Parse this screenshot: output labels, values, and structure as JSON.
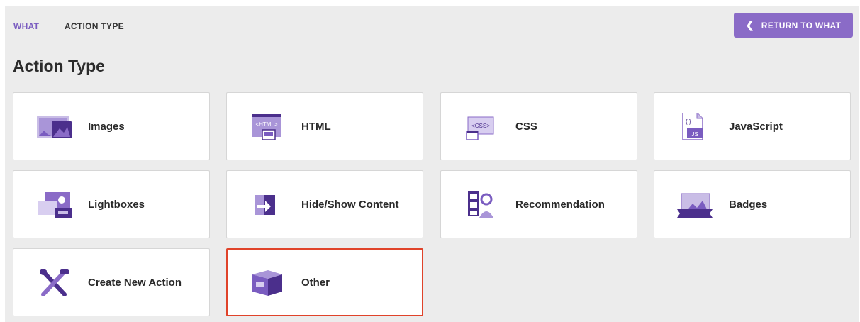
{
  "breadcrumb": {
    "parent": "WHAT",
    "current": "ACTION TYPE"
  },
  "return_button": {
    "label": "RETURN TO WHAT",
    "icon": "chevron-left-icon"
  },
  "page_title": "Action Type",
  "colors": {
    "accent": "#8a6bc7",
    "icon_dark": "#4b2f8c",
    "selected_border": "#e0432a"
  },
  "cards": [
    {
      "label": "Images",
      "icon": "images-icon"
    },
    {
      "label": "HTML",
      "icon": "html-icon",
      "icon_text": "<HTML>"
    },
    {
      "label": "CSS",
      "icon": "css-icon",
      "icon_text": "<CSS>"
    },
    {
      "label": "JavaScript",
      "icon": "javascript-icon",
      "icon_text": "JS"
    },
    {
      "label": "Lightboxes",
      "icon": "lightboxes-icon"
    },
    {
      "label": "Hide/Show Content",
      "icon": "hide-show-icon"
    },
    {
      "label": "Recommendation",
      "icon": "recommendation-icon"
    },
    {
      "label": "Badges",
      "icon": "badges-icon"
    },
    {
      "label": "Create New Action",
      "icon": "tools-icon"
    },
    {
      "label": "Other",
      "icon": "box-icon",
      "selected": true
    }
  ]
}
